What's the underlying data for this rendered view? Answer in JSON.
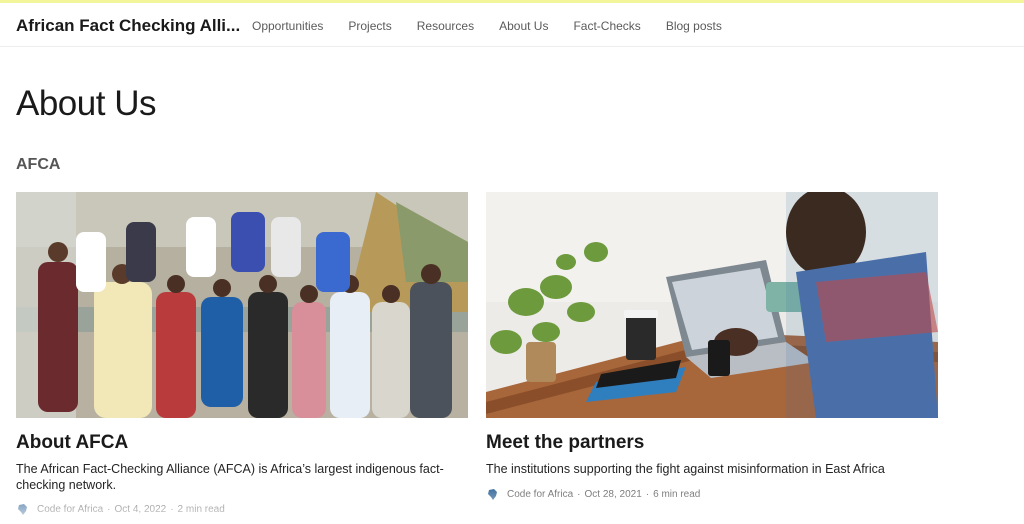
{
  "header": {
    "brand": "African Fact Checking Alli...",
    "nav": [
      "Opportunities",
      "Projects",
      "Resources",
      "About Us",
      "Fact-Checks",
      "Blog posts"
    ]
  },
  "page": {
    "title": "About Us",
    "section": "AFCA"
  },
  "cards": [
    {
      "title": "About AFCA",
      "description": "The African Fact-Checking Alliance (AFCA) is Africa’s largest indigenous fact-checking network.",
      "author": "Code for Africa",
      "date": "Oct 4, 2022",
      "read_time": "2 min read",
      "image": "group-photo"
    },
    {
      "title": "Meet the partners",
      "description": "The institutions supporting the fight against misinformation in East Africa",
      "author": "Code for Africa",
      "date": "Oct 28, 2021",
      "read_time": "6 min read",
      "image": "laptop-desk-photo"
    }
  ],
  "colors": {
    "accent_bar": "#f2f59a",
    "text": "#242424",
    "muted": "#6b6b6b"
  }
}
